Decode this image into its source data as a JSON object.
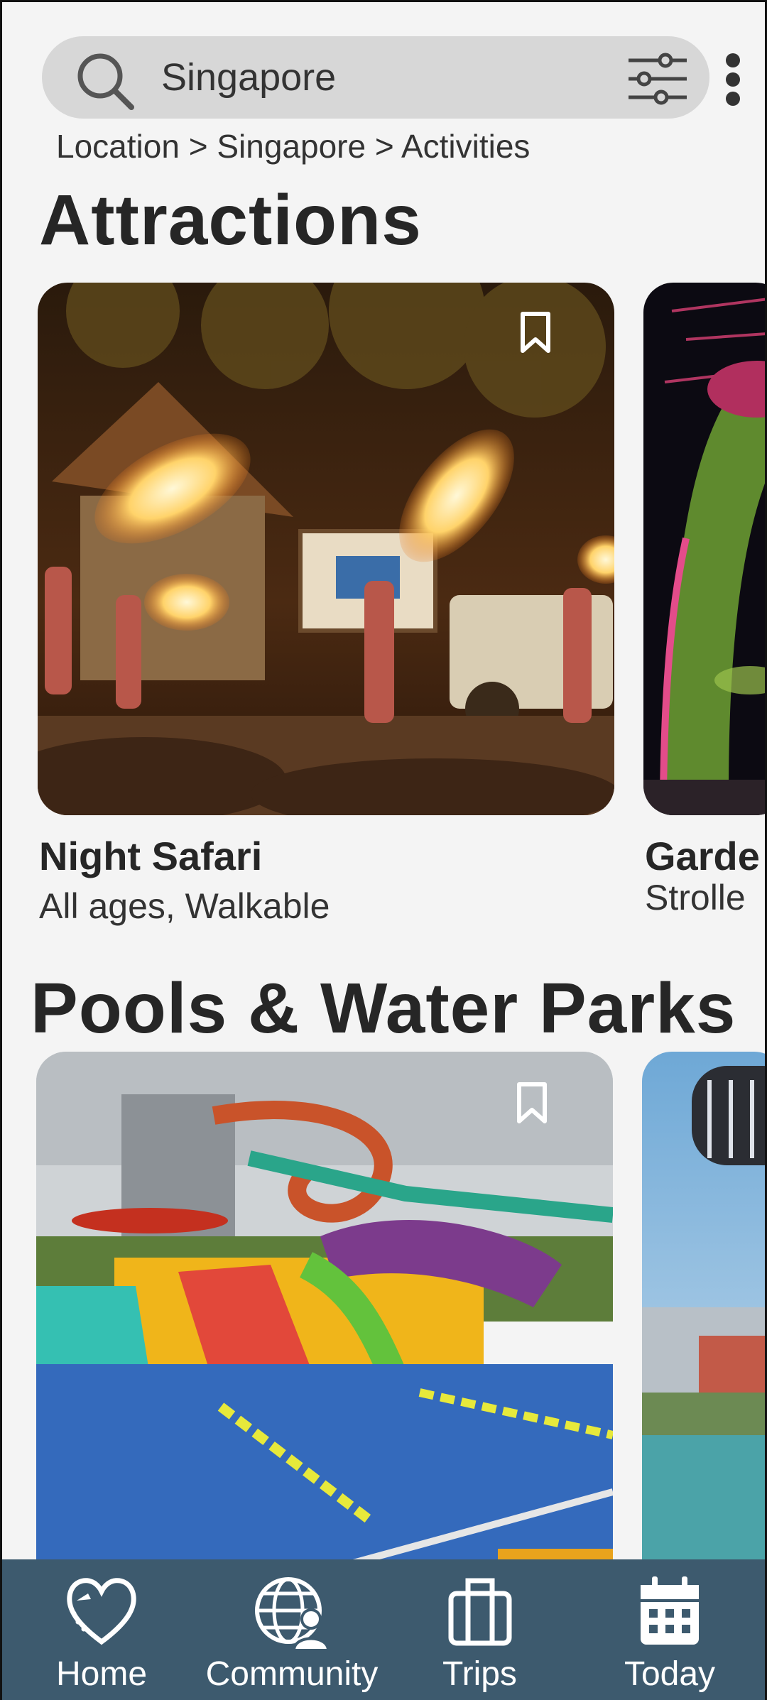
{
  "search": {
    "value": "Singapore"
  },
  "breadcrumb": "Location > Singapore > Activities",
  "sections": [
    {
      "title": "Attractions",
      "cards": [
        {
          "title": "Night Safari",
          "subtitle": "All ages, Walkable"
        },
        {
          "title": "Garde",
          "subtitle": "Strolle"
        }
      ]
    },
    {
      "title": "Pools & Water Parks",
      "cards": [
        {
          "title": "",
          "subtitle": ""
        },
        {
          "title": "",
          "subtitle": ""
        }
      ]
    }
  ],
  "nav": {
    "items": [
      {
        "label": "Home",
        "icon": "heart-plane-icon"
      },
      {
        "label": "Community",
        "icon": "globe-person-icon"
      },
      {
        "label": "Trips",
        "icon": "luggage-icon"
      },
      {
        "label": "Today",
        "icon": "calendar-icon"
      }
    ]
  },
  "colors": {
    "nav_bg": "#3d5a6e",
    "search_bg": "#d7d7d7",
    "page_bg": "#f4f4f4"
  }
}
